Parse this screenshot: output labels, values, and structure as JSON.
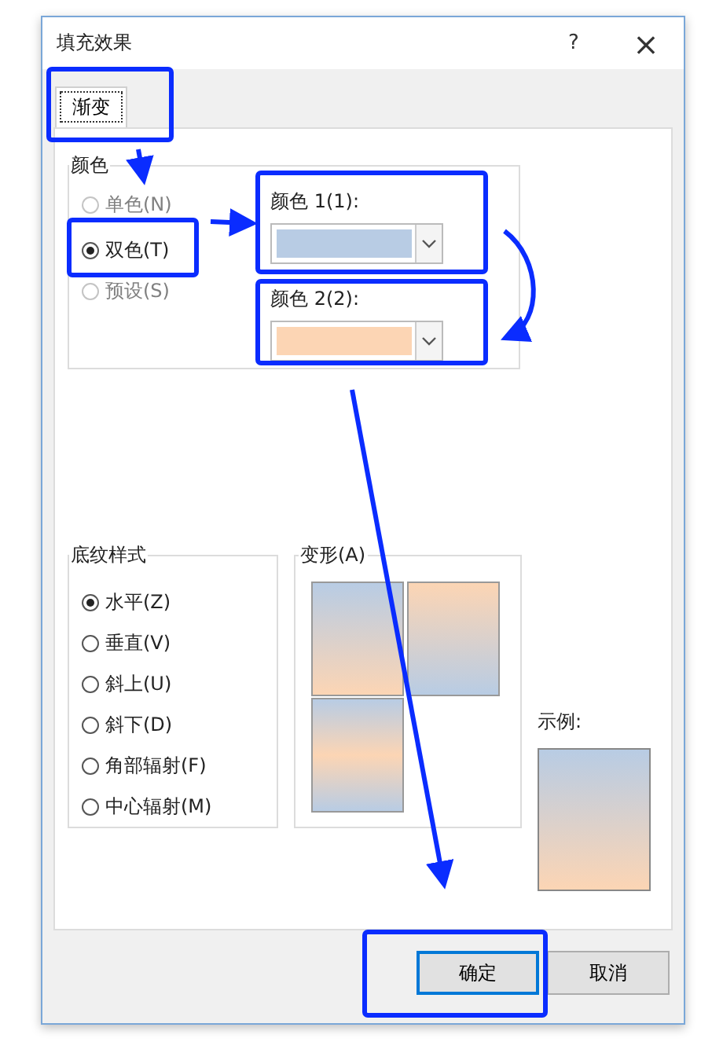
{
  "window": {
    "title": "填充效果",
    "help": "?",
    "close": "×"
  },
  "tabs": [
    {
      "label": "渐变",
      "selected": true
    }
  ],
  "colors": {
    "legend": "颜色",
    "options": [
      {
        "label": "单色(N)",
        "selected": false,
        "disabled": true
      },
      {
        "label": "双色(T)",
        "selected": true,
        "disabled": false
      },
      {
        "label": "预设(S)",
        "selected": false,
        "disabled": true
      }
    ],
    "color1": {
      "label": "颜色 1(1):",
      "color": "#b8cce4"
    },
    "color2": {
      "label": "颜色 2(2):",
      "color": "#fcd5b4"
    }
  },
  "shading_styles": {
    "legend": "底纹样式",
    "options": [
      {
        "label": "水平(Z)",
        "selected": true
      },
      {
        "label": "垂直(V)",
        "selected": false
      },
      {
        "label": "斜上(U)",
        "selected": false
      },
      {
        "label": "斜下(D)",
        "selected": false
      },
      {
        "label": "角部辐射(F)",
        "selected": false
      },
      {
        "label": "中心辐射(M)",
        "selected": false
      }
    ]
  },
  "variants": {
    "legend": "变形(A)",
    "items": [
      {
        "kind": "down"
      },
      {
        "kind": "up"
      },
      {
        "kind": "middle"
      }
    ]
  },
  "sample": {
    "label": "示例:"
  },
  "buttons": [
    {
      "label": "确定",
      "default": true
    },
    {
      "label": "取消",
      "default": false
    }
  ]
}
